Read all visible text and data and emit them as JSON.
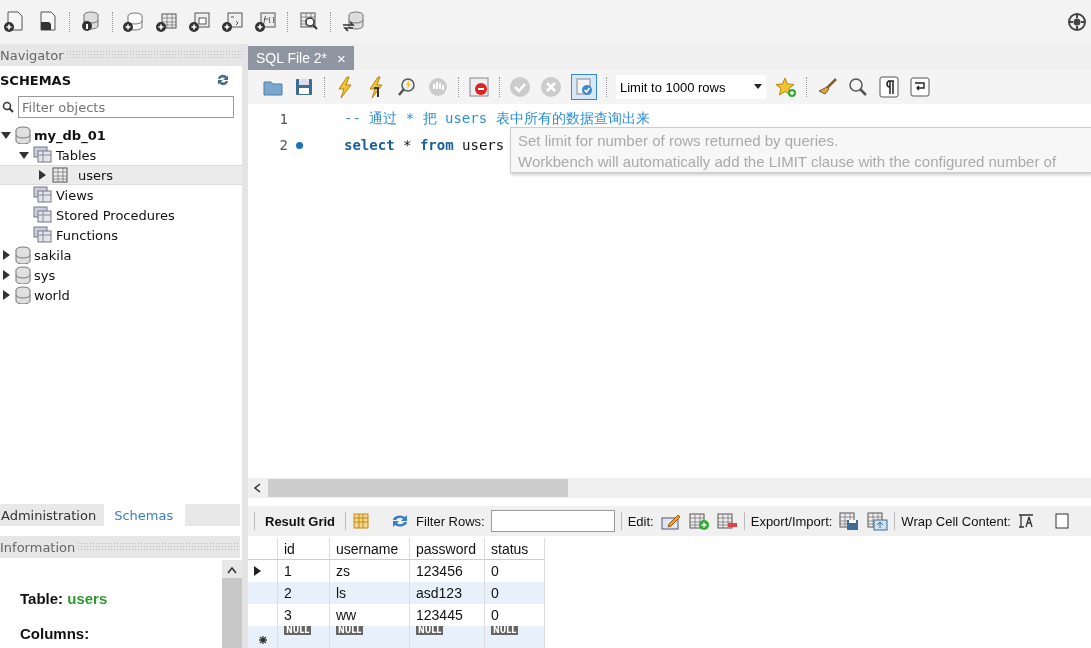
{
  "navigator": {
    "title": "Navigator",
    "section": "SCHEMAS",
    "filter": {
      "placeholder": "Filter objects"
    },
    "tree": [
      {
        "label": "my_db_01",
        "kind": "schema",
        "default": true,
        "expanded": true,
        "selected": false,
        "children": [
          {
            "label": "Tables",
            "kind": "folder",
            "expanded": true,
            "selected": false,
            "children": [
              {
                "label": "users",
                "kind": "table",
                "expanded": false,
                "selected": true
              }
            ]
          },
          {
            "label": "Views",
            "kind": "folder",
            "selected": false
          },
          {
            "label": "Stored Procedures",
            "kind": "folder",
            "selected": false
          },
          {
            "label": "Functions",
            "kind": "folder",
            "selected": false
          }
        ]
      },
      {
        "label": "sakila",
        "kind": "schema",
        "default": false,
        "expanded": false,
        "selected": false
      },
      {
        "label": "sys",
        "kind": "schema",
        "default": false,
        "expanded": false,
        "selected": false
      },
      {
        "label": "world",
        "kind": "schema",
        "default": false,
        "expanded": false,
        "selected": false
      }
    ]
  },
  "bottom_tabs": [
    {
      "label": "Administration",
      "selected": false
    },
    {
      "label": "Schemas",
      "selected": true
    }
  ],
  "information": {
    "title": "Information",
    "table_label": "Table:",
    "table_name": "users",
    "columns_label": "Columns:"
  },
  "editor": {
    "tabs": [
      {
        "label": "SQL File 2*",
        "close": "×",
        "selected": true
      }
    ],
    "limit": {
      "value": "Limit to 1000 rows"
    },
    "lines": [
      {
        "number": "1",
        "marker": false,
        "tokens": [
          {
            "text": "-- 通过 * 把 users 表中所有的数据查询出来",
            "kind": "comment"
          }
        ]
      },
      {
        "number": "2",
        "marker": true,
        "tokens": [
          {
            "text": "select",
            "kind": "keyword"
          },
          {
            "text": " * ",
            "kind": "plain"
          },
          {
            "text": "from",
            "kind": "keyword"
          },
          {
            "text": " users",
            "kind": "plain"
          }
        ]
      }
    ],
    "tooltip": [
      "Set limit for number of rows returned by queries.",
      "Workbench will automatically add the LIMIT clause with the configured number of"
    ]
  },
  "results": {
    "tab": "Result Grid",
    "filter_label": "Filter Rows:",
    "edit_label": "Edit:",
    "export_label": "Export/Import:",
    "wrap_label": "Wrap Cell Content:",
    "columns": [
      "id",
      "username",
      "password",
      "status"
    ],
    "rows": [
      {
        "cells": [
          "1",
          "zs",
          "123456",
          "0"
        ],
        "selected": true
      },
      {
        "cells": [
          "2",
          "ls",
          "asd123",
          "0"
        ],
        "selected": false
      },
      {
        "cells": [
          "3",
          "ww",
          "123445",
          "0"
        ],
        "selected": false
      }
    ],
    "new_row": [
      "NULL",
      "NULL",
      "NULL",
      "NULL"
    ]
  }
}
